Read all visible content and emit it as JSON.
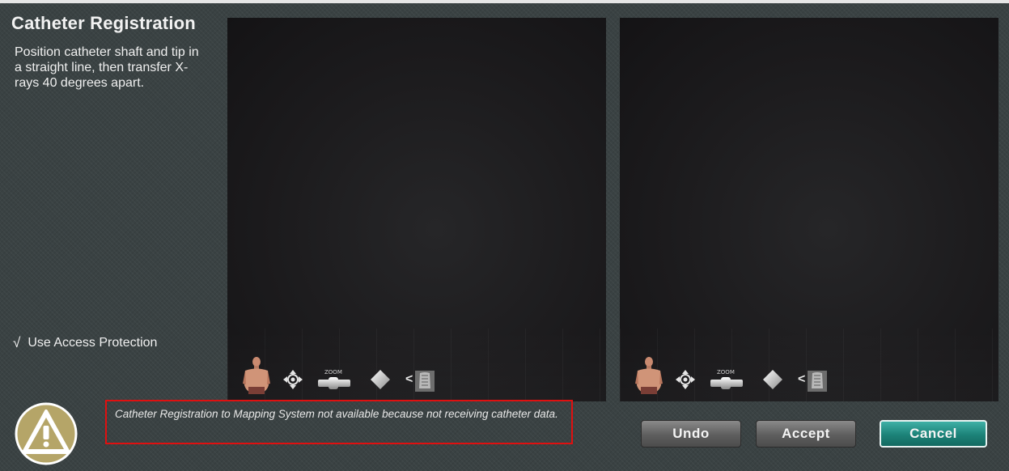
{
  "panel": {
    "title": "Catheter Registration",
    "instructions": "Position catheter shaft and tip in a straight line, then transfer X-rays 40 degrees apart.",
    "access_protection": {
      "checked": true,
      "check_glyph": "√",
      "label": "Use Access Protection"
    }
  },
  "viewports": [
    {
      "toolbar": {
        "icons": [
          "torso-icon",
          "move-icon",
          "zoom-slider",
          "diamond-icon",
          "xray-transfer-icon"
        ],
        "zoom_label": "ZOOM",
        "xray_arrow": "<"
      }
    },
    {
      "toolbar": {
        "icons": [
          "torso-icon",
          "move-icon",
          "zoom-slider",
          "diamond-icon",
          "xray-transfer-icon"
        ],
        "zoom_label": "ZOOM",
        "xray_arrow": "<"
      }
    }
  ],
  "status": {
    "icon": "warning-icon",
    "message": "Catheter Registration to Mapping System not available because not receiving catheter data."
  },
  "buttons": {
    "undo": "Undo",
    "accept": "Accept",
    "cancel": "Cancel"
  },
  "colors": {
    "warning_fill": "#b5a568",
    "message_border": "#e01010",
    "cancel_accent": "#1c8278"
  }
}
